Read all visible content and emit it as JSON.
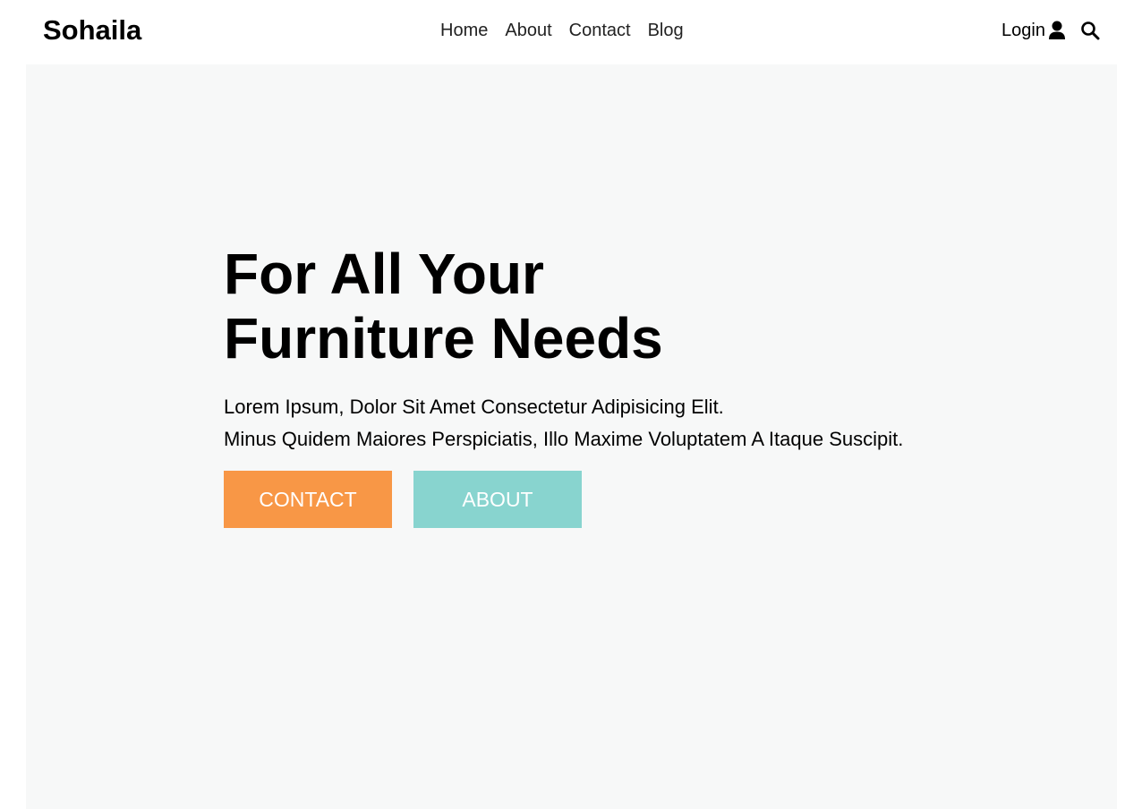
{
  "brand": {
    "name": "Sohaila"
  },
  "nav": {
    "items": [
      "Home",
      "About",
      "Contact",
      "Blog"
    ]
  },
  "header_tools": {
    "login_label": "Login",
    "login_icon": "user-icon",
    "search_icon": "search-icon"
  },
  "hero": {
    "headline_line1": "For All Your",
    "headline_line2": "Furniture Needs",
    "subtext_line1": "Lorem Ipsum, Dolor Sit Amet Consectetur Adipisicing Elit.",
    "subtext_line2": "Minus Quidem Maiores Perspiciatis, Illo Maxime Voluptatem A Itaque Suscipit.",
    "contact_button": "CONTACT",
    "about_button": "ABOUT"
  },
  "colors": {
    "hero_background": "#f7f8f8",
    "contact_button": "#f89746",
    "about_button": "#88d4cf"
  }
}
